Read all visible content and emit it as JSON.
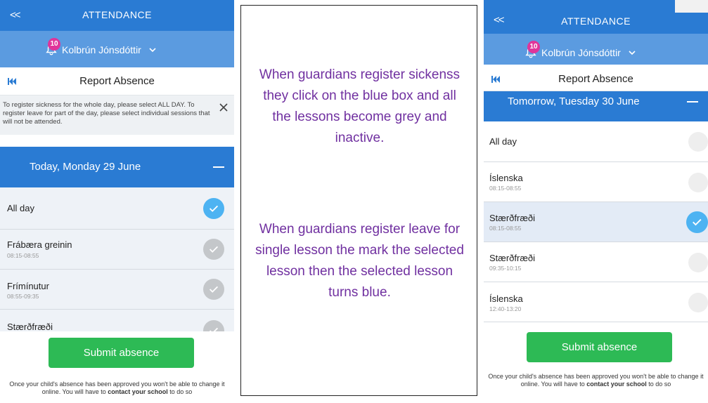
{
  "colors": {
    "primary_blue": "#2a7bd3",
    "light_blue_bar": "#5b9be0",
    "check_blue": "#4db3f2",
    "submit_green": "#2dba55",
    "badge_pink": "#e0359a",
    "annotation_purple": "#7030a0"
  },
  "left_screen": {
    "header": {
      "back_label": "<<",
      "title": "ATTENDANCE"
    },
    "user": {
      "badge_count": "10",
      "name": "Kolbrún Jónsdóttir",
      "bell_icon": "bell-icon",
      "dropdown_icon": "chevron-down-icon"
    },
    "report": {
      "title": "Report Absence",
      "skip_icon": "skip-back-icon"
    },
    "notice": {
      "text": "To register sickness for the whole day, please select ALL DAY. To register leave for part of the day, please select individual sessions that will not be attended.",
      "close_icon": "close-icon"
    },
    "day_header": {
      "label": "Today, Monday 29 June",
      "collapse_icon": "minus-icon"
    },
    "rows": [
      {
        "name": "All day",
        "time": "",
        "state": "checked"
      },
      {
        "name": "Frábæra greinin",
        "time": "08:15-08:55",
        "state": "disabled"
      },
      {
        "name": "Frímínutur",
        "time": "08:55-09:35",
        "state": "disabled"
      },
      {
        "name": "Stærðfræði",
        "time": "",
        "state": "disabled"
      }
    ],
    "submit_label": "Submit absence",
    "footnote": {
      "before": "Once your child's absence has been approved you won't be able to change it online. You will have to ",
      "bold": "contact your school",
      "after": " to do so"
    }
  },
  "annotations": {
    "first": "When guardians register sickenss they click on the blue box and all the lessons become grey and inactive.",
    "second": "When guardians register leave for single lesson the mark the selected lesson then the selected lesson turns blue."
  },
  "right_screen": {
    "header": {
      "back_label": "<<",
      "title": "ATTENDANCE"
    },
    "user": {
      "badge_count": "10",
      "name": "Kolbrún Jónsdóttir",
      "bell_icon": "bell-icon",
      "dropdown_icon": "chevron-down-icon"
    },
    "report": {
      "title": "Report Absence",
      "skip_icon": "skip-back-icon"
    },
    "day_header": {
      "label": "Tomorrow, Tuesday 30 June",
      "collapse_icon": "minus-icon"
    },
    "rows": [
      {
        "name": "All day",
        "time": "",
        "state": "unchecked"
      },
      {
        "name": "Íslenska",
        "time": "08:15-08:55",
        "state": "unchecked"
      },
      {
        "name": "Stærðfræði",
        "time": "08:15-08:55",
        "state": "checked"
      },
      {
        "name": "Stærðfræði",
        "time": "09:35-10:15",
        "state": "unchecked"
      },
      {
        "name": "Íslenska",
        "time": "12:40-13:20",
        "state": "unchecked"
      }
    ],
    "submit_label": "Submit absence",
    "footnote": {
      "before": "Once your child's absence has been approved you won't be able to change it online. You will have to ",
      "bold": "contact your school",
      "after": " to do so"
    }
  }
}
